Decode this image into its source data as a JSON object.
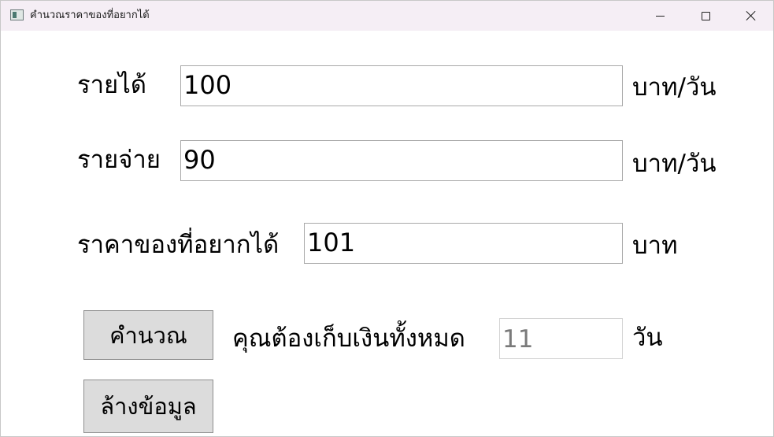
{
  "window": {
    "title": "คำนวณราคาของที่อยากได้",
    "icons": {
      "app": "app-icon",
      "minimize": "minimize-icon",
      "maximize": "maximize-icon",
      "close": "close-icon"
    }
  },
  "form": {
    "income": {
      "label": "รายได้",
      "value": "100",
      "unit": "บาท/วัน"
    },
    "expense": {
      "label": "รายจ่าย",
      "value": "90",
      "unit": "บาท/วัน"
    },
    "price": {
      "label": "ราคาของที่อยากได้",
      "value": "101",
      "unit": "บาท"
    },
    "result": {
      "label": "คุณต้องเก็บเงินทั้งหมด",
      "value": "11",
      "unit": "วัน"
    }
  },
  "buttons": {
    "calculate": "คำนวณ",
    "clear": "ล้างข้อมูล"
  }
}
